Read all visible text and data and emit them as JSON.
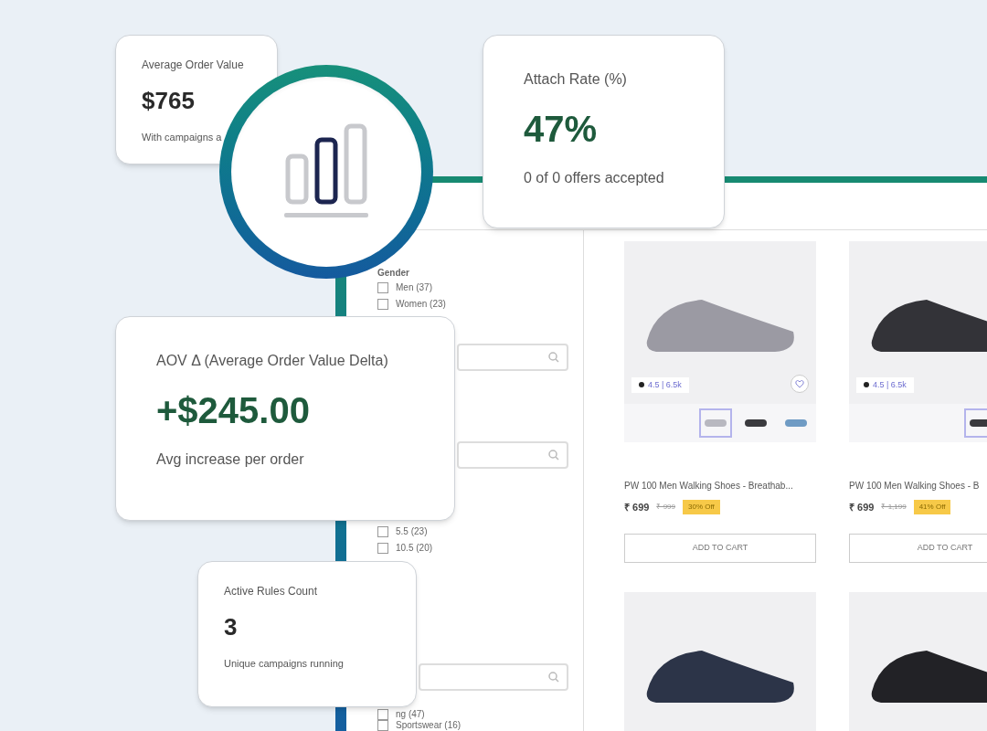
{
  "metrics": [
    {
      "kind": "small",
      "label": "Average Order Value",
      "value": "$765",
      "note": "With campaigns a"
    },
    {
      "kind": "large",
      "label": "Attach Rate (%)",
      "value": "47%",
      "note": "0 of 0 offers accepted"
    },
    {
      "kind": "large",
      "label": "AOV Δ (Average Order Value Delta)",
      "value": "+$245.00",
      "note": "Avg increase per order"
    },
    {
      "kind": "small",
      "label": "Active Rules Count",
      "value": "3",
      "note": "Unique campaigns running"
    }
  ],
  "store": {
    "filters": [
      {
        "kind": "list",
        "heading": "Gender",
        "options": [
          {
            "label": "Men (37)",
            "checked": false
          },
          {
            "label": "Women (23)",
            "checked": false
          }
        ]
      },
      {
        "kind": "search"
      },
      {
        "kind": "search",
        "options": [
          {
            "label": "5.5 (23)",
            "checked": false
          },
          {
            "label": "10.5 (20)",
            "checked": false
          }
        ]
      },
      {
        "kind": "search",
        "options": [
          {
            "label": "ng (47)",
            "checked": false
          },
          {
            "label": "Sportswear (16)",
            "checked": false
          }
        ]
      }
    ],
    "products": [
      {
        "rating": "4.5 | 6.5k",
        "title": "PW 100 Men Walking Shoes - Breathab...",
        "price": "₹ 699",
        "mrp": "₹ 999",
        "discount": "30% Off",
        "button": "ADD TO CART"
      },
      {
        "rating": "4.5 | 6.5k",
        "title": "PW 100 Men Walking Shoes - B",
        "price": "₹ 699",
        "mrp": "₹ 1,199",
        "discount": "41% Off",
        "button": "ADD TO CART"
      }
    ]
  }
}
